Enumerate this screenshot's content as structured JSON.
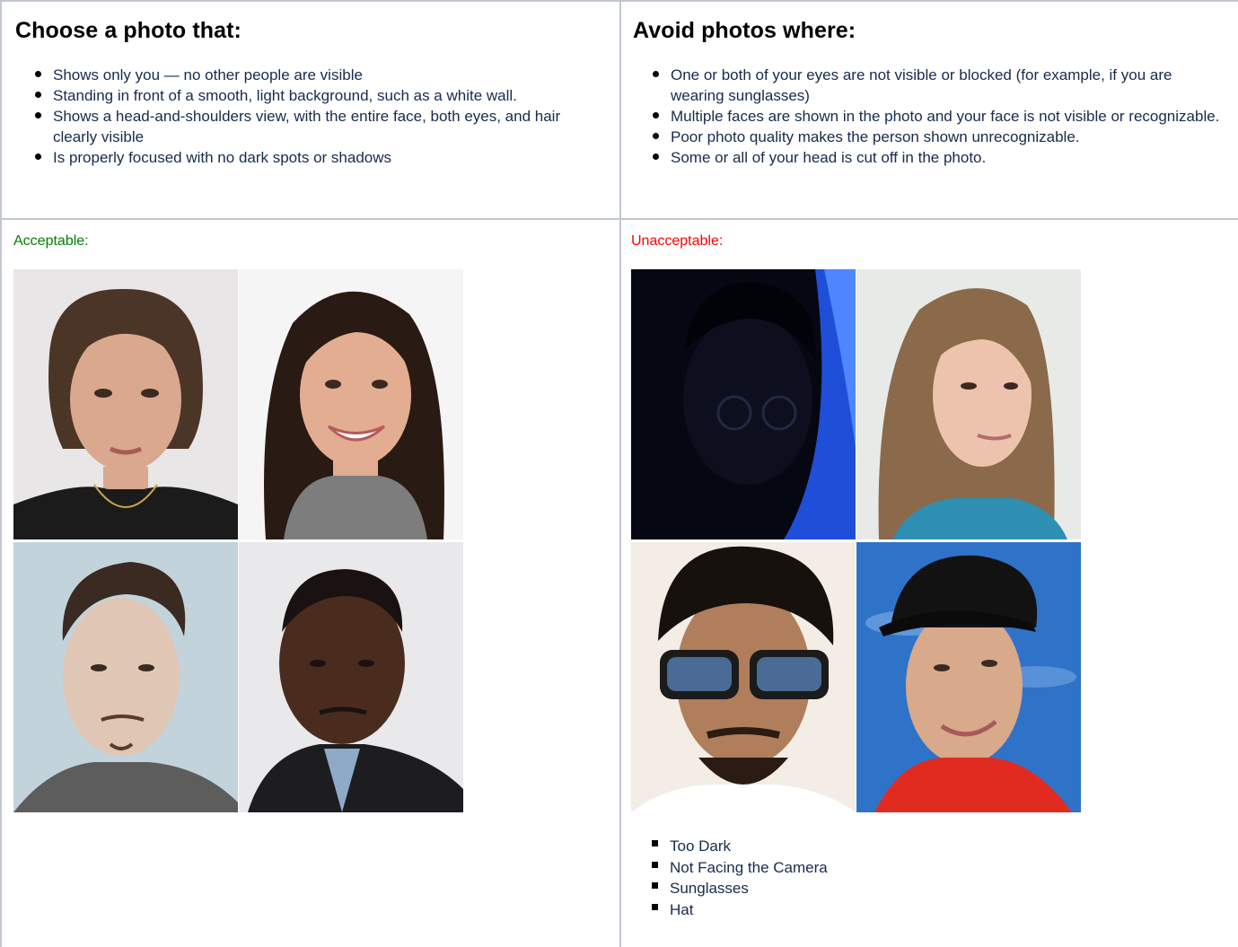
{
  "choose": {
    "title": "Choose a photo that:",
    "items": [
      "Shows only you — no other people are visible",
      "Standing in front of a smooth, light background, such as a white wall.",
      "Shows a head-and-shoulders view, with the entire face, both eyes, and hair clearly visible",
      "Is properly focused with no dark spots or shadows"
    ]
  },
  "avoid": {
    "title": "Avoid photos where:",
    "items": [
      "One or both of your eyes are not visible or blocked (for example, if you are wearing sunglasses)",
      "Multiple faces are shown in the photo and your face is not visible or recognizable.",
      "Poor photo quality makes the person shown unrecognizable.",
      "Some or all of your head is cut off in the photo."
    ]
  },
  "acceptable": {
    "label": "Acceptable:",
    "color": "#008000",
    "photos": [
      "woman-brown-hair-neutral-photo",
      "woman-long-hair-smiling-photo",
      "man-styled-hair-photo",
      "man-dark-suit-photo"
    ]
  },
  "unacceptable": {
    "label": "Unacceptable:",
    "color": "#ff0000",
    "photos": [
      "too-dark-photo",
      "not-facing-camera-photo",
      "sunglasses-photo",
      "hat-photo"
    ],
    "reasons": [
      "Too Dark",
      "Not Facing the Camera",
      "Sunglasses",
      "Hat"
    ]
  }
}
